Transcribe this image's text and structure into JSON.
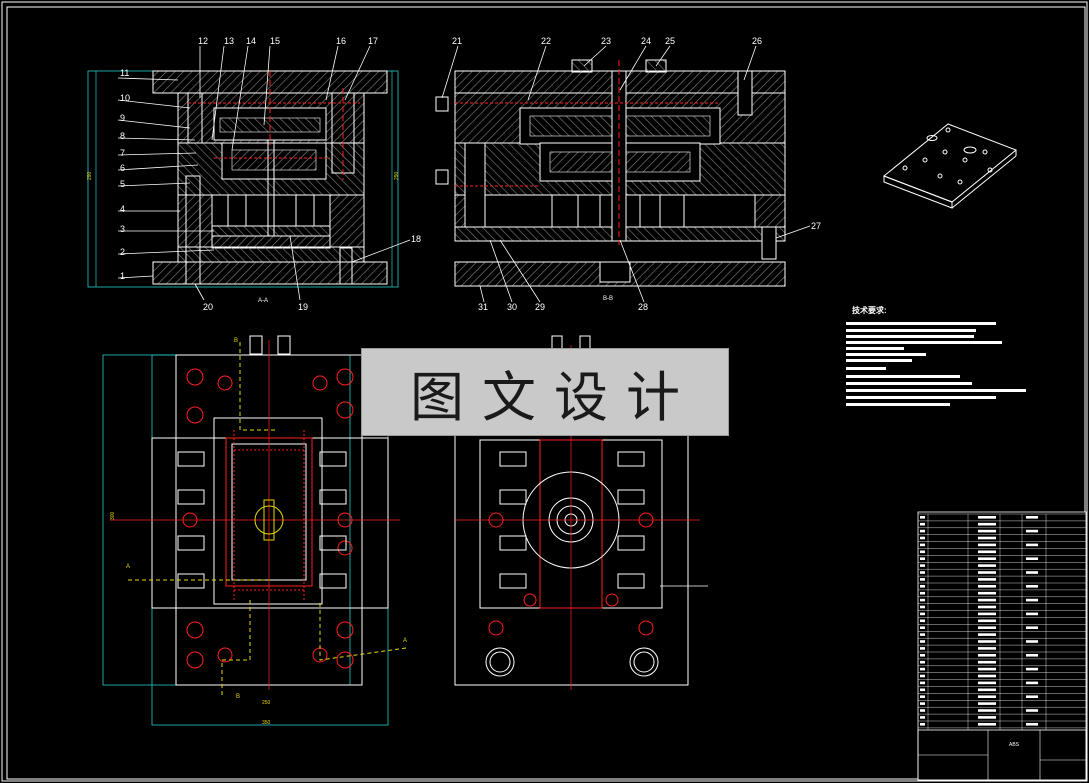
{
  "section_labels": {
    "a": "A-A",
    "b": "B-B"
  },
  "dimension_labels": {
    "height_a": "290",
    "height_b": "290",
    "width_plan": "250",
    "outer_width_plan": "350",
    "depth_plan": "300"
  },
  "callouts_left": [
    "11",
    "10",
    "9",
    "8",
    "7",
    "6",
    "5",
    "4",
    "3",
    "2",
    "1"
  ],
  "callouts_top_a": [
    "12",
    "13",
    "14",
    "15",
    "16",
    "17"
  ],
  "callouts_bottom_a": [
    "20",
    "19"
  ],
  "callout_right_a": "18",
  "callouts_top_b": [
    "21",
    "22",
    "23",
    "24",
    "25",
    "26"
  ],
  "callouts_bottom_b": [
    "31",
    "30",
    "29",
    "28"
  ],
  "callout_right_b": "27",
  "tech_title": "技术要求:",
  "section_markers": [
    "A",
    "A",
    "B",
    "B"
  ],
  "title_block": {
    "material": "ABS"
  },
  "watermark": "图文设计",
  "colors": {
    "background": "#000000",
    "line": "#ffffff",
    "hatch": "#8a8a8a",
    "red": "#ff2020",
    "cyan": "#22cccc",
    "yellow": "#e8d800",
    "green": "#18c018"
  }
}
